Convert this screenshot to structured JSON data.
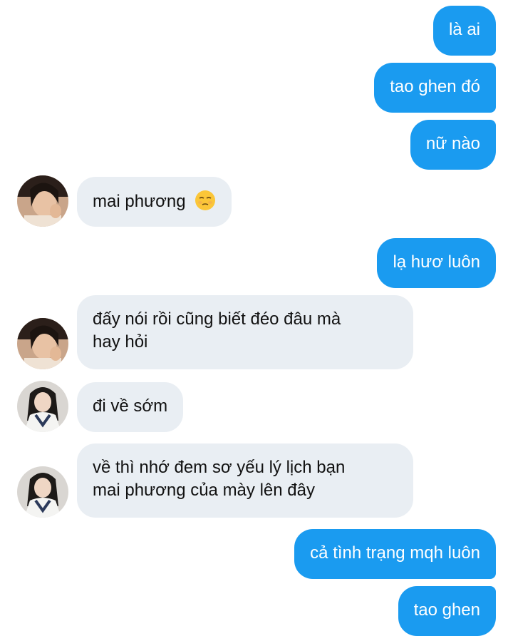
{
  "messages": [
    {
      "side": "out",
      "text": "là ai"
    },
    {
      "side": "out",
      "text": "tao ghen đó"
    },
    {
      "side": "out",
      "text": "nữ nào"
    },
    {
      "side": "in",
      "sender": "girl-a",
      "text": "mai phương",
      "emoji": "unamused-face-icon"
    },
    {
      "side": "out",
      "text": "lạ hươ luôn"
    },
    {
      "side": "in",
      "sender": "girl-a",
      "text_line1": "đấy nói rồi cũng biết đéo đâu mà",
      "text_line2": "hay hỏi"
    },
    {
      "side": "in",
      "sender": "girl-b",
      "text": "đi về sớm"
    },
    {
      "side": "in",
      "sender": "girl-b",
      "text_line1": "về thì nhớ đem sơ yếu lý lịch bạn",
      "text_line2": "mai phương của mày lên đây"
    },
    {
      "side": "out",
      "text": "cả tình trạng mqh luôn"
    },
    {
      "side": "out",
      "text": "tao ghen"
    }
  ],
  "colors": {
    "outgoing_bubble": "#1a9bf0",
    "incoming_bubble": "#e9eef3",
    "outgoing_text": "#ffffff",
    "incoming_text": "#111111"
  }
}
